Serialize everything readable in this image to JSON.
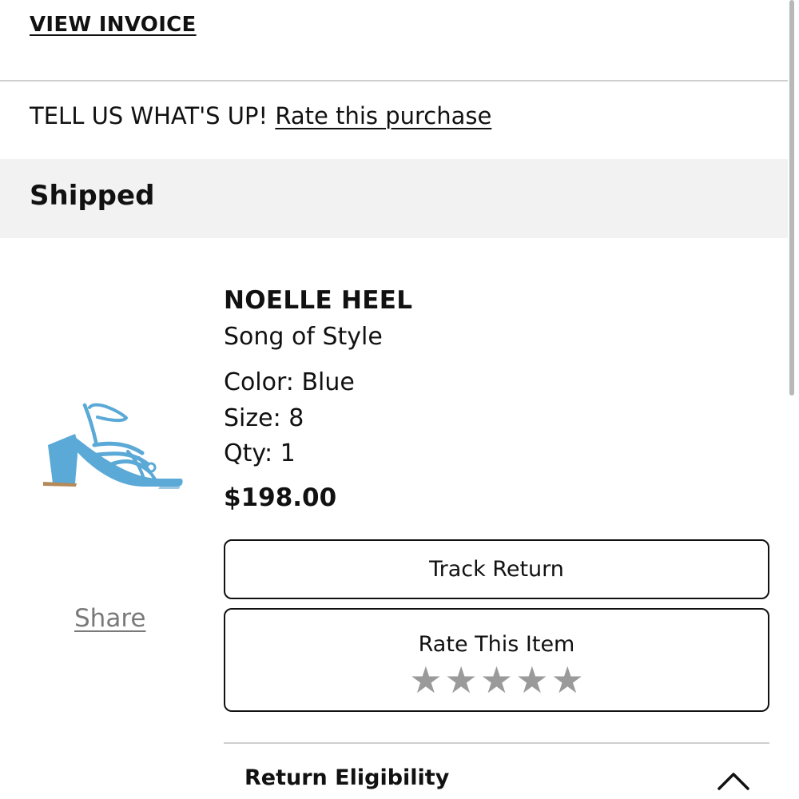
{
  "invoice": {
    "label": "VIEW INVOICE"
  },
  "feedback": {
    "prompt": "TELL US WHAT'S UP!",
    "link_label": "Rate this purchase"
  },
  "shipment": {
    "status": "Shipped"
  },
  "product": {
    "name": "NOELLE HEEL",
    "brand": "Song of Style",
    "color": "Color: Blue",
    "size": "Size: 8",
    "qty": "Qty: 1",
    "price": "$198.00",
    "image_icon": "blue-strappy-heel-sandal",
    "image_color": "#5aa9d6"
  },
  "share": {
    "label": "Share"
  },
  "actions": {
    "track_return_label": "Track Return",
    "rate_item_label": "Rate This Item",
    "rating": {
      "value": 0,
      "max": 5,
      "star_glyph": "★",
      "star_color": "#9a9a9a"
    }
  },
  "accordion": {
    "return_eligibility_label": "Return Eligibility",
    "expanded": true,
    "icon": "chevron-up-icon"
  }
}
